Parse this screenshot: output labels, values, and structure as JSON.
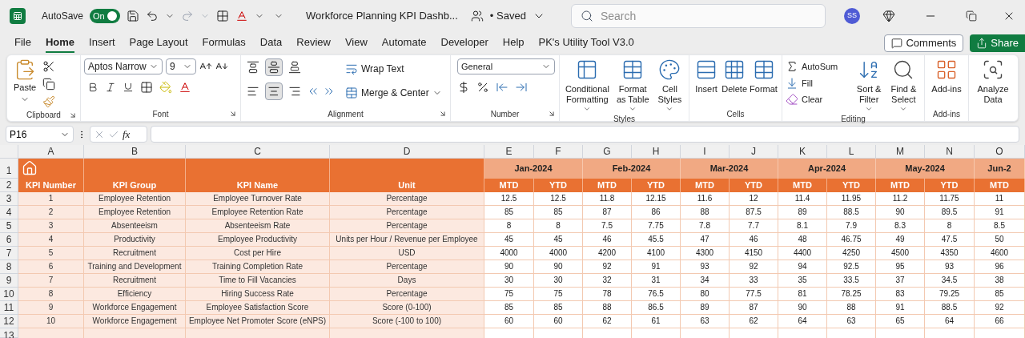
{
  "title_bar": {
    "autosave_label": "AutoSave",
    "autosave": {
      "on": true,
      "label": "On"
    },
    "file_title": "Workforce Planning KPI Dashb...",
    "save_status": "• Saved",
    "search": {
      "placeholder": "Search"
    },
    "avatar": "SS"
  },
  "menu_tabs": [
    {
      "label": "File",
      "selected": false
    },
    {
      "label": "Home",
      "selected": true
    },
    {
      "label": "Insert",
      "selected": false
    },
    {
      "label": "Page Layout",
      "selected": false
    },
    {
      "label": "Formulas",
      "selected": false
    },
    {
      "label": "Data",
      "selected": false
    },
    {
      "label": "Review",
      "selected": false
    },
    {
      "label": "View",
      "selected": false
    },
    {
      "label": "Automate",
      "selected": false
    },
    {
      "label": "Developer",
      "selected": false
    },
    {
      "label": "Help",
      "selected": false
    },
    {
      "label": "PK's Utility Tool V3.0",
      "selected": false
    }
  ],
  "comments_button": "Comments",
  "share_button": "Share",
  "ribbon": {
    "clipboard": {
      "paste": "Paste",
      "label": "Clipboard"
    },
    "font": {
      "font_name": "Aptos Narrow",
      "font_size": "9",
      "label": "Font"
    },
    "alignment": {
      "vertical": [
        {
          "kind": "top",
          "selected": false
        },
        {
          "kind": "middle",
          "selected": true
        },
        {
          "kind": "bottom",
          "selected": false
        }
      ],
      "horizontal": [
        {
          "kind": "left",
          "selected": false
        },
        {
          "kind": "center",
          "selected": true
        },
        {
          "kind": "right",
          "selected": false
        }
      ],
      "wrap_text": "Wrap Text",
      "merge_center": "Merge & Center",
      "label": "Alignment"
    },
    "number": {
      "format": "General",
      "label": "Number"
    },
    "styles": {
      "buttons": [
        "Conditional Formatting",
        "Format as Table",
        "Cell Styles"
      ],
      "label": "Styles"
    },
    "cells": {
      "buttons": [
        "Insert",
        "Delete",
        "Format"
      ],
      "label": "Cells"
    },
    "editing": {
      "autosum": "AutoSum",
      "fill": "Fill",
      "clear": "Clear",
      "sort_filter": "Sort & Filter",
      "find_select": "Find & Select",
      "label": "Editing"
    },
    "addins": {
      "button": "Add-ins",
      "label": "Add-ins"
    },
    "analyze": {
      "button": "Analyze Data"
    }
  },
  "formula_bar": {
    "name_box": "P16",
    "function_label": "fx"
  },
  "sheet": {
    "columns": [
      "A",
      "B",
      "C",
      "D",
      "E",
      "F",
      "G",
      "H",
      "I",
      "J",
      "K",
      "L",
      "M",
      "N",
      "O"
    ],
    "row_numbers": [
      "1",
      "2",
      "3",
      "4",
      "5",
      "6",
      "7",
      "8",
      "9",
      "10",
      "11",
      "12",
      "13"
    ],
    "months": [
      "Jan-2024",
      "Feb-2024",
      "Mar-2024",
      "Apr-2024",
      "May-2024",
      "Jun-2"
    ],
    "headers": [
      "KPI Number",
      "KPI Group",
      "KPI Name",
      "Unit"
    ],
    "sub_headers": [
      "MTD",
      "YTD",
      "MTD",
      "YTD",
      "MTD",
      "YTD",
      "MTD",
      "YTD",
      "MTD",
      "YTD",
      "MTD"
    ],
    "rows": [
      {
        "kpi_number": "1",
        "group": "Employee Retention",
        "name": "Employee Turnover Rate",
        "unit": "Percentage",
        "values": [
          "12.5",
          "12.5",
          "11.8",
          "12.15",
          "11.6",
          "12",
          "11.4",
          "11.95",
          "11.2",
          "11.75",
          "11"
        ]
      },
      {
        "kpi_number": "2",
        "group": "Employee Retention",
        "name": "Employee Retention Rate",
        "unit": "Percentage",
        "values": [
          "85",
          "85",
          "87",
          "86",
          "88",
          "87.5",
          "89",
          "88.5",
          "90",
          "89.5",
          "91"
        ]
      },
      {
        "kpi_number": "3",
        "group": "Absenteeism",
        "name": "Absenteeism Rate",
        "unit": "Percentage",
        "values": [
          "8",
          "8",
          "7.5",
          "7.75",
          "7.8",
          "7.7",
          "8.1",
          "7.9",
          "8.3",
          "8",
          "8.5"
        ]
      },
      {
        "kpi_number": "4",
        "group": "Productivity",
        "name": "Employee Productivity",
        "unit": "Units per Hour / Revenue per Employee",
        "values": [
          "45",
          "45",
          "46",
          "45.5",
          "47",
          "46",
          "48",
          "46.75",
          "49",
          "47.5",
          "50"
        ]
      },
      {
        "kpi_number": "5",
        "group": "Recruitment",
        "name": "Cost per Hire",
        "unit": "USD",
        "values": [
          "4000",
          "4000",
          "4200",
          "4100",
          "4300",
          "4150",
          "4400",
          "4250",
          "4500",
          "4350",
          "4600"
        ]
      },
      {
        "kpi_number": "6",
        "group": "Training and Development",
        "name": "Training Completion Rate",
        "unit": "Percentage",
        "values": [
          "90",
          "90",
          "92",
          "91",
          "93",
          "92",
          "94",
          "92.5",
          "95",
          "93",
          "96"
        ]
      },
      {
        "kpi_number": "7",
        "group": "Recruitment",
        "name": "Time to Fill Vacancies",
        "unit": "Days",
        "values": [
          "30",
          "30",
          "32",
          "31",
          "34",
          "33",
          "35",
          "33.5",
          "37",
          "34.5",
          "38"
        ]
      },
      {
        "kpi_number": "8",
        "group": "Efficiency",
        "name": "Hiring Success Rate",
        "unit": "Percentage",
        "values": [
          "75",
          "75",
          "78",
          "76.5",
          "80",
          "77.5",
          "81",
          "78.25",
          "83",
          "79.25",
          "85"
        ]
      },
      {
        "kpi_number": "9",
        "group": "Workforce Engagement",
        "name": "Employee Satisfaction Score",
        "unit": "Score (0-100)",
        "values": [
          "85",
          "85",
          "88",
          "86.5",
          "89",
          "87",
          "90",
          "88",
          "91",
          "88.5",
          "92"
        ]
      },
      {
        "kpi_number": "10",
        "group": "Workforce Engagement",
        "name": "Employee Net Promoter Score (eNPS)",
        "unit": "Score (-100 to 100)",
        "values": [
          "60",
          "60",
          "62",
          "61",
          "63",
          "62",
          "64",
          "63",
          "65",
          "64",
          "66"
        ]
      }
    ]
  }
}
